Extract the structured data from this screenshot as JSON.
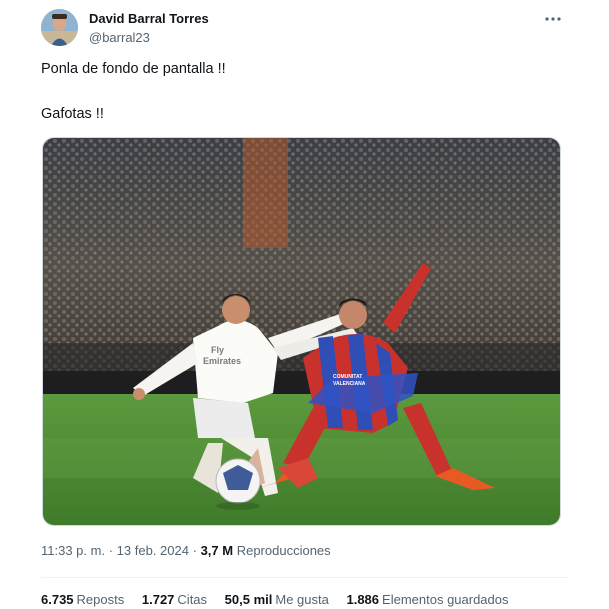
{
  "tweet": {
    "author": {
      "name": "David Barral Torres",
      "handle": "@barral23"
    },
    "text_lines": [
      "Ponla de fondo de pantalla !!",
      "Gafotas !!"
    ],
    "meta": {
      "time": "11:33 p. m.",
      "date": "13 feb. 2024",
      "views": "3,7 M",
      "views_label": "Reproducciones",
      "sep": "·"
    },
    "stats": [
      {
        "value": "6.735",
        "label": "Reposts"
      },
      {
        "value": "1.727",
        "label": "Citas"
      },
      {
        "value": "50,5 mil",
        "label": "Me gusta"
      },
      {
        "value": "1.886",
        "label": "Elementos guardados"
      }
    ],
    "photo": {
      "jersey_sponsor": "Fly Emirates",
      "jersey_sponsor_line1": "Fly",
      "jersey_sponsor_line2": "Emirates",
      "opponent_sponsor_line1": "COMUNITAT",
      "opponent_sponsor_line2": "VALENCIANA"
    },
    "colors": {
      "text": "#0f1419",
      "secondary": "#536471",
      "divider": "#eff3f4"
    }
  }
}
